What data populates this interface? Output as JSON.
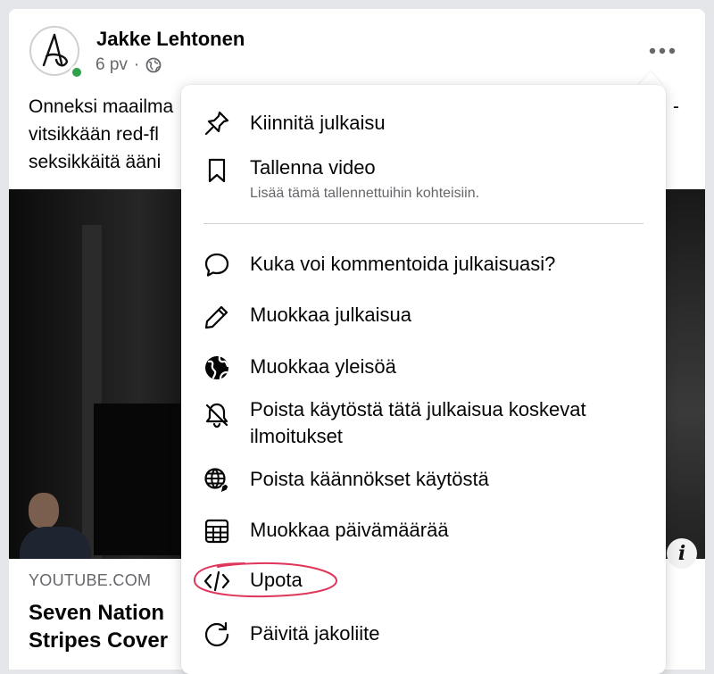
{
  "post": {
    "author": "Jakke Lehtonen",
    "time": "6 pv",
    "separator": "·",
    "text_lines": [
      "Onneksi maailma",
      "vitsikkään red-fl",
      "seksikkäitä ääni"
    ],
    "text_trailing": "-",
    "link_domain": "YOUTUBE.COM",
    "link_title_lines": [
      "Seven Nation",
      "Stripes Cover"
    ],
    "info_glyph": "i",
    "online_color": "#31a24c"
  },
  "menu": {
    "items": [
      {
        "icon": "pin-icon",
        "label": "Kiinnitä julkaisu"
      },
      {
        "icon": "bookmark-icon",
        "label": "Tallenna video",
        "sublabel": "Lisää tämä tallennettuihin kohteisiin."
      },
      {
        "icon": "comment-icon",
        "label": "Kuka voi kommentoida julkaisuasi?"
      },
      {
        "icon": "pencil-icon",
        "label": "Muokkaa julkaisua"
      },
      {
        "icon": "globe-icon",
        "label": "Muokkaa yleisöä"
      },
      {
        "icon": "bell-off-icon",
        "label_lines": [
          "Poista käytöstä tätä julkaisua koskevat",
          "ilmoitukset"
        ]
      },
      {
        "icon": "translate-globe-icon",
        "label": "Poista käännökset käytöstä"
      },
      {
        "icon": "calendar-grid-icon",
        "label": "Muokkaa päivämäärää"
      },
      {
        "icon": "code-icon",
        "label": "Upota",
        "annotation": "red-hand-drawn-circle"
      },
      {
        "icon": "refresh-icon",
        "label": "Päivitä jakoliite"
      }
    ],
    "highlight_color": "#e0365a"
  }
}
